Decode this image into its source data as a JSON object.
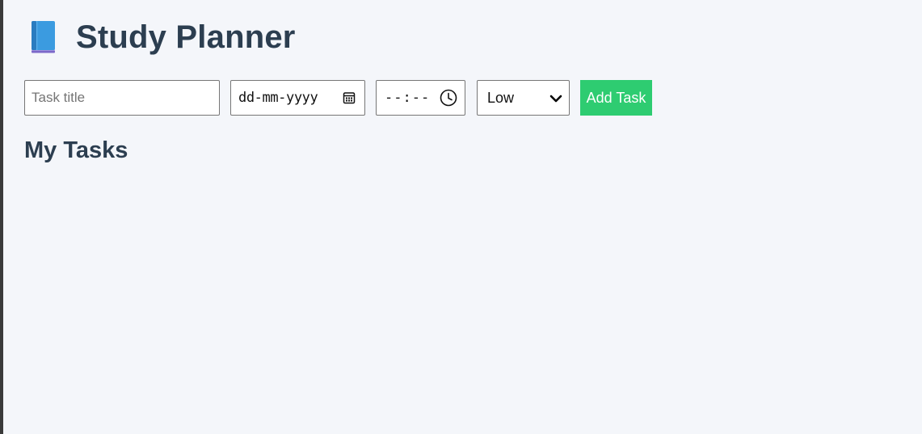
{
  "header": {
    "icon": "book-icon",
    "title": "Study Planner"
  },
  "form": {
    "title_input": {
      "placeholder": "Task title",
      "value": ""
    },
    "date_input": {
      "placeholder": "dd-mm-yyyy",
      "icon": "calendar-icon"
    },
    "time_input": {
      "placeholder": "--:--",
      "icon": "clock-icon"
    },
    "priority_select": {
      "selected": "Low",
      "icon": "chevron-down-icon"
    },
    "add_button_label": "Add Task"
  },
  "tasks": {
    "heading": "My Tasks",
    "items": []
  },
  "colors": {
    "background": "#f4f6fa",
    "heading": "#2c3e50",
    "add_button": "#2ecc71",
    "book_icon": "#3b9be0"
  }
}
